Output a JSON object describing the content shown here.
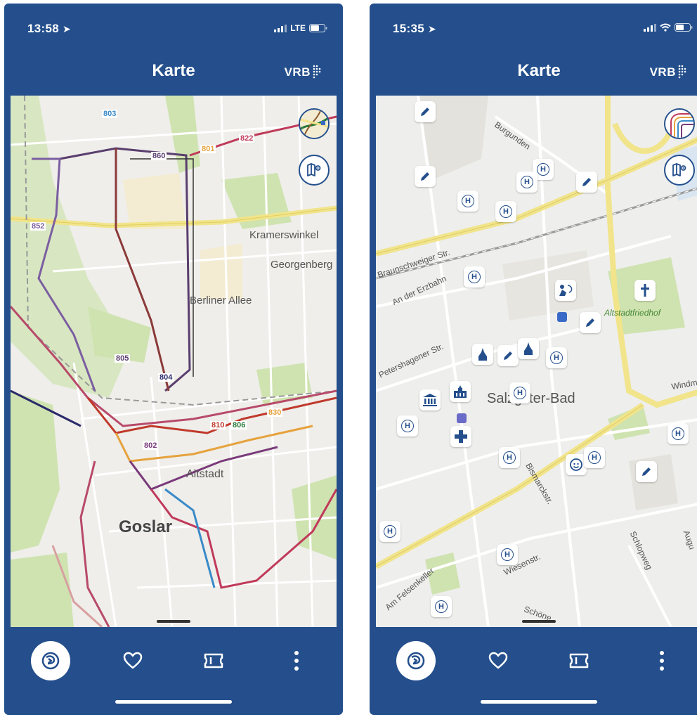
{
  "screens": [
    {
      "status": {
        "time": "13:58",
        "network": "LTE"
      },
      "header": {
        "title": "Karte",
        "logo": "VRB"
      },
      "map": {
        "labels": {
          "town": "Goslar",
          "district1": "Altstadt",
          "place1": "Kramerswinkel",
          "place2": "Georgenberg",
          "street1": "Berliner Allee",
          "route_a": "822",
          "route_b": "860",
          "route_c": "804",
          "route_d": "801",
          "route_e": "810",
          "route_f": "806",
          "route_g": "830",
          "route_h": "803",
          "route_i": "802",
          "route_j": "852",
          "route_k": "805"
        }
      }
    },
    {
      "status": {
        "time": "15:35"
      },
      "header": {
        "title": "Karte",
        "logo": "VRB"
      },
      "map": {
        "labels": {
          "town": "Salzgitter-Bad",
          "cemetery": "Altstadtfriedhof",
          "street1": "Braunschweiger Str.",
          "street2": "An der Erzbahn",
          "street3": "Petershagener Str.",
          "street4": "Bismarckstr.",
          "street5": "Wiesenstr.",
          "street6": "Schlopweg",
          "street7": "Am Felsenkeller",
          "street8": "Burgunden",
          "street9": "Windmühlenstr.",
          "street10": "Augu",
          "street11": "Schöne",
          "stop_letter": "H"
        }
      }
    }
  ],
  "colors": {
    "brand": "#244f8c",
    "map_bg": "#efeeea",
    "road": "#f1e48a",
    "green": "#cfe3b0"
  },
  "icons": {
    "tab1": "route-planner-icon",
    "tab2": "heart-icon",
    "tab3": "ticket-icon",
    "tab4": "more-vertical-icon",
    "map_btn1": "map-layer-icon",
    "map_btn2": "map-settings-icon"
  }
}
